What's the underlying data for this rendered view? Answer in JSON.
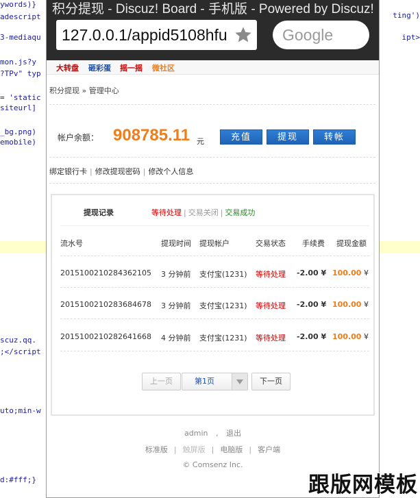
{
  "background_code": {
    "left_lines": [
      "ywords)}",
      "adescript",
      "3-mediaqu",
      "mon.js?y",
      "?TPv\" typ",
      "= 'static",
      "siteurl]",
      "_bg.png)",
      "emobile)",
      "scuz.qq.",
      ";</script",
      "uto;min-w",
      "d:#fff;}"
    ],
    "right_lines": [
      "ting')",
      "ipt>"
    ]
  },
  "browser": {
    "window_title": "积分提现 - Discuz! Board - 手机版 - Powered by Discuz!",
    "url": "127.0.0.1/appid5108hfu",
    "search_placeholder": "Google"
  },
  "quicknav": {
    "items": [
      "大转盘",
      "砸彩蛋",
      "摇一摇",
      "微社区"
    ]
  },
  "breadcrumb": "积分提现 » 管理中心",
  "account": {
    "balance_label": "帐户余额：",
    "balance_value": "908785.11",
    "balance_unit": "元",
    "buttons": [
      "充值",
      "提现",
      "转帐"
    ],
    "links": [
      "绑定银行卡",
      "修改提现密码",
      "修改个人信息"
    ]
  },
  "records": {
    "title": "提现记录",
    "filters": [
      "等待处理",
      "交易关闭",
      "交易成功"
    ],
    "columns": [
      "流水号",
      "提现时间",
      "提现帐户",
      "交易状态",
      "手续费",
      "提现金额"
    ],
    "rows": [
      {
        "serial": "2015100210284362105",
        "time": "3 分钟前",
        "account": "支付宝(1231)",
        "status": "等待处理",
        "fee": "-2.00 ¥",
        "amount": "100.00",
        "currency": "¥"
      },
      {
        "serial": "2015100210283684678",
        "time": "3 分钟前",
        "account": "支付宝(1231)",
        "status": "等待处理",
        "fee": "-2.00 ¥",
        "amount": "100.00",
        "currency": "¥"
      },
      {
        "serial": "2015100210282641668",
        "time": "4 分钟前",
        "account": "支付宝(1231)",
        "status": "等待处理",
        "fee": "-2.00 ¥",
        "amount": "100.00",
        "currency": "¥"
      }
    ],
    "pager": {
      "prev": "上一页",
      "current": "第1页",
      "next": "下一页"
    }
  },
  "footer": {
    "user": "admin",
    "logout": "退出",
    "links": [
      "标准版",
      "触屏版",
      "电脑版",
      "客户端"
    ],
    "copyright": "© Comsenz Inc."
  },
  "watermark": "跟版网模板",
  "colors": {
    "accent_orange": "#f07d1a",
    "button_blue": "#1f63b6",
    "status_red": "#cc0000",
    "success_green": "#228b22"
  }
}
